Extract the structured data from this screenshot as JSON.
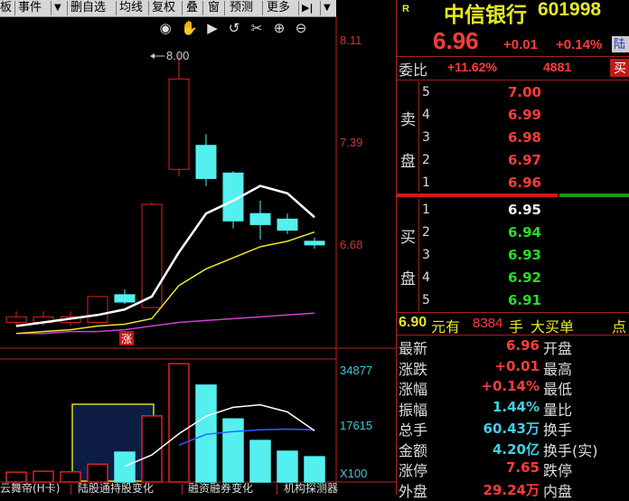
{
  "toolbar": {
    "items": [
      "板",
      "事件",
      "▼",
      "删自选",
      "均线",
      "复权",
      "叠",
      "窗",
      "预测",
      "更多",
      "▶|",
      "▼"
    ]
  },
  "chart_tools": [
    "eye-icon",
    "hand-icon",
    "play-icon",
    "undo-icon",
    "scissors-icon",
    "zoom-in-icon",
    "zoom-out-icon"
  ],
  "chart_tool_glyphs": [
    "◉",
    "✋",
    "▶",
    "↺",
    "✂",
    "⊕",
    "⊖"
  ],
  "chart": {
    "price_labels": [
      "8.11",
      "7.39",
      "6.68"
    ],
    "high_annotation": "8.00",
    "limit_up_badge": "涨",
    "volume_labels": [
      "34877",
      "17615",
      "X100"
    ]
  },
  "bottom_tabs": [
    "云舞帝(H卡)",
    "陆股通持股变化",
    "融资融券变化",
    "机构探测器"
  ],
  "chart_data": {
    "type": "candlestick",
    "candles": [
      {
        "open": 6.54,
        "close": 6.57,
        "high": 6.6,
        "low": 6.52
      },
      {
        "open": 6.54,
        "close": 6.57,
        "high": 6.6,
        "low": 6.52
      },
      {
        "open": 6.54,
        "close": 6.57,
        "high": 6.6,
        "low": 6.52
      },
      {
        "open": 6.54,
        "close": 6.68,
        "high": 6.68,
        "low": 6.53
      },
      {
        "open": 6.69,
        "close": 6.65,
        "high": 6.72,
        "low": 6.64
      },
      {
        "open": 6.62,
        "close": 7.18,
        "high": 7.19,
        "low": 6.62
      },
      {
        "open": 7.37,
        "close": 7.86,
        "high": 8.0,
        "low": 7.33
      },
      {
        "open": 7.5,
        "close": 7.32,
        "high": 7.56,
        "low": 7.28
      },
      {
        "open": 7.35,
        "close": 7.09,
        "high": 7.36,
        "low": 7.05
      },
      {
        "open": 7.13,
        "close": 7.07,
        "high": 7.2,
        "low": 6.99
      },
      {
        "open": 7.1,
        "close": 7.04,
        "high": 7.13,
        "low": 7.02
      },
      {
        "open": 6.98,
        "close": 6.96,
        "high": 7.0,
        "low": 6.94
      }
    ],
    "ma5": [
      6.52,
      6.54,
      6.56,
      6.58,
      6.61,
      6.68,
      6.92,
      7.13,
      7.2,
      7.28,
      7.24,
      7.11
    ],
    "ma10": [
      6.48,
      6.49,
      6.5,
      6.52,
      6.53,
      6.56,
      6.74,
      6.83,
      6.89,
      6.95,
      6.98,
      7.03
    ],
    "ma30": [
      6.48,
      6.48,
      6.49,
      6.49,
      6.5,
      6.52,
      6.54,
      6.55,
      6.56,
      6.57,
      6.58,
      6.59
    ],
    "volumes": [
      3200,
      3500,
      3300,
      5800,
      9700,
      21500,
      38500,
      31500,
      20500,
      13500,
      10000,
      8200
    ],
    "vol_ma5": [
      null,
      null,
      null,
      null,
      5100,
      8800,
      15700,
      21400,
      24300,
      25100,
      22800,
      16700
    ],
    "vol_ma10": [
      null,
      null,
      null,
      null,
      null,
      null,
      12000,
      15500,
      16400,
      17000,
      17200,
      17000
    ],
    "price_axis": [
      6.4,
      8.2
    ],
    "volume_axis": [
      0,
      40000
    ]
  },
  "quote": {
    "badge": "R",
    "name": "中信银行",
    "code": "601998",
    "price": "6.96",
    "change": "+0.01",
    "change_pct": "+0.14%",
    "market_tag": "陆",
    "weibi_label": "委比",
    "weibi_value": "+11.62%",
    "weicha": "4881",
    "weicha_tag": "买",
    "sell_label": [
      "卖",
      "盘"
    ],
    "buy_label": [
      "买",
      "盘"
    ],
    "asks": [
      {
        "level": "5",
        "price": "7.00"
      },
      {
        "level": "4",
        "price": "6.99"
      },
      {
        "level": "3",
        "price": "6.98"
      },
      {
        "level": "2",
        "price": "6.97"
      },
      {
        "level": "1",
        "price": "6.96"
      }
    ],
    "bids": [
      {
        "level": "1",
        "price": "6.95"
      },
      {
        "level": "2",
        "price": "6.94"
      },
      {
        "level": "3",
        "price": "6.93"
      },
      {
        "level": "4",
        "price": "6.92"
      },
      {
        "level": "5",
        "price": "6.91"
      }
    ],
    "tick": {
      "price": "6.90",
      "unit": "元有",
      "qty": "8384",
      "qty_unit": "手",
      "label": "大买单",
      "tail": "点"
    },
    "stats_left": [
      {
        "label": "最新",
        "value": "6.96",
        "color": "#ff3b3b"
      },
      {
        "label": "涨跌",
        "value": "+0.01",
        "color": "#ff3b3b"
      },
      {
        "label": "涨幅",
        "value": "+0.14%",
        "color": "#ff3b3b"
      },
      {
        "label": "振幅",
        "value": "1.44%",
        "color": "#3fd0e6"
      },
      {
        "label": "总手",
        "value": "60.43万",
        "color": "#3fd0e6"
      },
      {
        "label": "金额",
        "value": "4.20亿",
        "color": "#3fd0e6"
      },
      {
        "label": "涨停",
        "value": "7.65",
        "color": "#ff3b3b"
      },
      {
        "label": "外盘",
        "value": "29.24万",
        "color": "#ff3b3b"
      }
    ],
    "stats_right": [
      "开盘",
      "最高",
      "最低",
      "量比",
      "换手",
      "换手(实)",
      "跌停",
      "内盘"
    ]
  },
  "colors": {
    "up": "#e02020",
    "down": "#54f0f0",
    "ma5": "#ffffff",
    "ma10": "#e8e820",
    "ma30": "#d040d0",
    "vol_ma10": "#3060ff",
    "bid_green": "#22e022",
    "ask_red": "#ff3b3b"
  }
}
